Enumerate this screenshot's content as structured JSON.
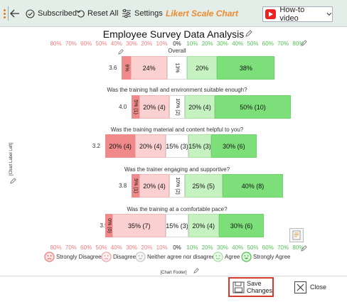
{
  "toolbar": {
    "subscribed_label": "Subscribed",
    "reset_label": "Reset All",
    "settings_label": "Settings",
    "app_title": "Likert Scale Chart",
    "howto_label": "How-to video"
  },
  "chart": {
    "title": "Employee Survey Data Analysis",
    "axis_ticks": [
      "80%",
      "70%",
      "60%",
      "50%",
      "40%",
      "30%",
      "20%",
      "10%",
      "0%",
      "10%",
      "20%",
      "30%",
      "40%",
      "50%",
      "60%",
      "70%",
      "80%"
    ],
    "y_label": "[Chart Label Left]",
    "footer": "[Chart Footer]",
    "colors": {
      "strongly_disagree": "#f08a8a",
      "disagree": "#fbd0d0",
      "neutral": "#ffffff",
      "agree": "#c6f2c2",
      "strongly_agree": "#7ddf7a",
      "neg_tick": "#f07b7b",
      "pos_tick": "#55c155",
      "save_border": "#d23b2b"
    }
  },
  "chart_data": {
    "type": "bar",
    "subtype": "diverging-stacked-likert",
    "x_range": [
      -80,
      80
    ],
    "categories": [
      "Strongly Disagree",
      "Disagree",
      "Neither agree nor disagree",
      "Agree",
      "Strongly Agree"
    ],
    "rows": [
      {
        "question": "Overall",
        "mean": "3.6",
        "values": [
          6,
          24,
          13,
          20,
          38
        ],
        "labels": [
          "6%",
          "24%",
          "13%",
          "20%",
          "38%"
        ]
      },
      {
        "question": "Was the training hall and environment suitable enough?",
        "mean": "4.0",
        "values": [
          5,
          20,
          10,
          20,
          50
        ],
        "labels": [
          "5% (1)",
          "20% (4)",
          "10% (2)",
          "20% (4)",
          "50% (10)"
        ]
      },
      {
        "question": "Was the training material and content helpful to you?",
        "mean": "3.2",
        "values": [
          20,
          20,
          15,
          15,
          30
        ],
        "labels": [
          "20% (4)",
          "20% (4)",
          "15% (3)",
          "15% (3)",
          "30% (6)"
        ]
      },
      {
        "question": "Was the trainer engaging and supportive?",
        "mean": "3.8",
        "values": [
          5,
          20,
          10,
          25,
          40
        ],
        "labels": [
          "5% (1)",
          "20% (4)",
          "10% (2)",
          "25% (5)",
          "40% (8)"
        ]
      },
      {
        "question": "Was the training at a comfortable pace?",
        "mean": "3.5",
        "values": [
          0,
          35,
          15,
          20,
          30
        ],
        "labels": [
          "0% (0)",
          "35% (7)",
          "15% (3)",
          "20% (4)",
          "30% (6)"
        ]
      }
    ],
    "legend": [
      "Strongly Disagree",
      "Disagree",
      "Neither agree nor disagree",
      "Agree",
      "Strongly Agree"
    ],
    "legend_position": "bottom"
  },
  "actions": {
    "save_label": "Save\nChanges",
    "close_label": "Close"
  }
}
